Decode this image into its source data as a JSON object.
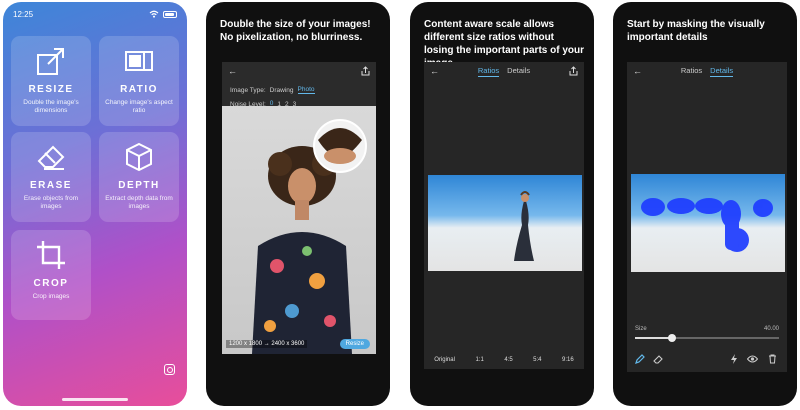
{
  "phone1": {
    "status_time": "12:25",
    "tiles": [
      {
        "title": "RESIZE",
        "desc": "Double the image's dimensions",
        "icon": "resize-icon"
      },
      {
        "title": "RATIO",
        "desc": "Change image's aspect ratio",
        "icon": "ratio-icon"
      },
      {
        "title": "ERASE",
        "desc": "Erase objects from images",
        "icon": "eraser-icon"
      },
      {
        "title": "DEPTH",
        "desc": "Extract depth data from images",
        "icon": "depth-cube-icon"
      },
      {
        "title": "CROP",
        "desc": "Crop images",
        "icon": "crop-icon"
      }
    ]
  },
  "phone2": {
    "caption": "Double the size of your images! No pixelization, no blurriness.",
    "image_type_label": "Image Type:",
    "image_type_options": [
      "Drawing",
      "Photo"
    ],
    "image_type_selected": "Photo",
    "noise_level_label": "Noise Level:",
    "noise_levels": [
      "0",
      "1",
      "2",
      "3"
    ],
    "noise_selected": "0",
    "dimensions": "1200 x 1800 → 2400 x 3600",
    "resize_button": "Resize"
  },
  "phone3": {
    "caption": "Content aware scale allows different size ratios without losing the important parts of your image",
    "tabs": [
      "Ratios",
      "Details"
    ],
    "active_tab": "Ratios",
    "ratios": [
      "Original",
      "1:1",
      "4:5",
      "5:4",
      "9:16"
    ]
  },
  "phone4": {
    "caption": "Start by masking the visually important details",
    "tabs": [
      "Ratios",
      "Details"
    ],
    "active_tab": "Details",
    "size_label": "Size",
    "size_value": "40.00",
    "size_fraction": 0.26
  },
  "colors": {
    "accent": "#62b8ea",
    "mask": "#1e3cff"
  }
}
